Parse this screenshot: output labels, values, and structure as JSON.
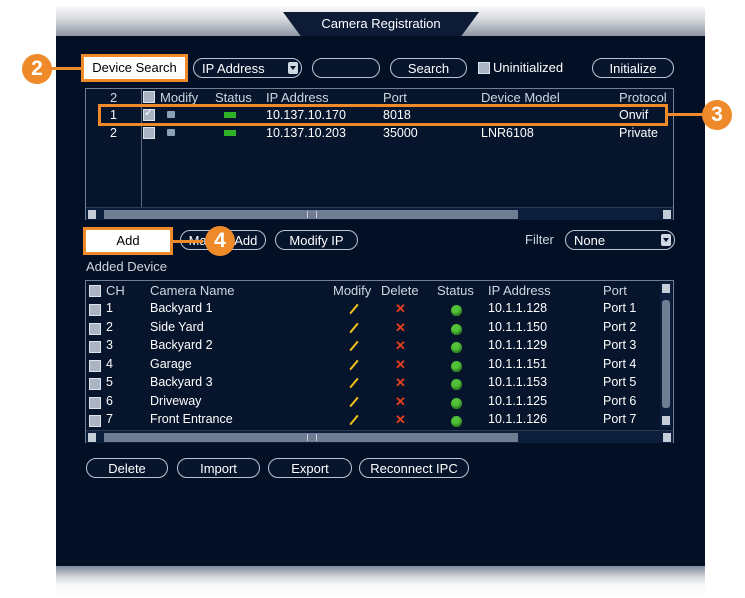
{
  "window": {
    "title": "Camera Registration"
  },
  "toolbar": {
    "device_search": "Device Search",
    "ip_select": "IP Address",
    "search_input": "",
    "search": "Search",
    "uninitialized": "Uninitialized",
    "initialize": "Initialize"
  },
  "callouts": {
    "c2": "2",
    "c3": "3",
    "c4": "4"
  },
  "search_table": {
    "columns": {
      "num": "2",
      "modify": "Modify",
      "status": "Status",
      "ip": "IP Address",
      "port": "Port",
      "model": "Device Model",
      "protocol": "Protocol"
    },
    "rows": [
      {
        "num": "1",
        "ip": "10.137.10.170",
        "port": "8018",
        "model": "",
        "protocol": "Onvif",
        "checked": true
      },
      {
        "num": "2",
        "ip": "10.137.10.203",
        "port": "35000",
        "model": "LNR6108",
        "protocol": "Private",
        "checked": false
      }
    ]
  },
  "actions": {
    "add": "Add",
    "manual_add": "Manual Add",
    "modify_ip": "Modify IP",
    "filter_label": "Filter",
    "filter_value": "None"
  },
  "added": {
    "section_title": "Added Device",
    "columns": {
      "ch": "CH",
      "name": "Camera Name",
      "modify": "Modify",
      "delete": "Delete",
      "status": "Status",
      "ip": "IP Address",
      "port": "Port"
    },
    "rows": [
      {
        "ch": "1",
        "name": "Backyard 1",
        "ip": "10.1.1.128",
        "port": "Port 1"
      },
      {
        "ch": "2",
        "name": "Side Yard",
        "ip": "10.1.1.150",
        "port": "Port 2"
      },
      {
        "ch": "3",
        "name": "Backyard 2",
        "ip": "10.1.1.129",
        "port": "Port 3"
      },
      {
        "ch": "4",
        "name": "Garage",
        "ip": "10.1.1.151",
        "port": "Port 4"
      },
      {
        "ch": "5",
        "name": "Backyard 3",
        "ip": "10.1.1.153",
        "port": "Port 5"
      },
      {
        "ch": "6",
        "name": "Driveway",
        "ip": "10.1.1.125",
        "port": "Port 6"
      },
      {
        "ch": "7",
        "name": "Front Entrance",
        "ip": "10.1.1.126",
        "port": "Port 7"
      }
    ]
  },
  "bottom": {
    "delete": "Delete",
    "import": "Import",
    "export": "Export",
    "reconnect": "Reconnect IPC"
  },
  "colors": {
    "accent": "#ef8a2b",
    "background": "#030f24",
    "status_online": "#52c23a",
    "delete_x": "#e8401e",
    "edit_pencil": "#f2c318"
  }
}
